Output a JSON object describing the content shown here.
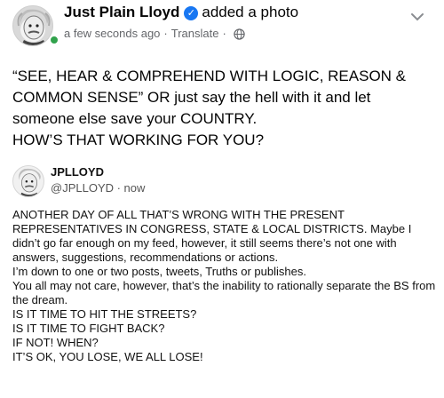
{
  "post": {
    "author": "Just Plain Lloyd",
    "action": "added a photo",
    "timestamp": "a few seconds ago",
    "separator": "·",
    "translate": "Translate",
    "verified_icon": "check-badge",
    "caption": "“SEE, HEAR & COMPREHEND WITH LOGIC, REASON & COMMON SENSE” OR just say the hell with it and let someone else save your COUNTRY.\nHOW’S THAT WORKING FOR YOU?"
  },
  "embedded": {
    "name": "JPLLOYD",
    "handle": "@JPLLOYD · now",
    "body": "ANOTHER DAY OF ALL THAT’S WRONG WITH THE PRESENT REPRESENTATIVES IN CONGRESS, STATE & LOCAL DISTRICTS. Maybe I didn’t go far enough on my feed, however, it still seems there’s not one with answers, suggestions, recommendations or actions.\nI’m down to one or two posts, tweets, Truths or publishes.\nYou all may not care, however, that’s the inability to rationally separate the BS from the dream.\nIS IT TIME TO HIT THE STREETS?\nIS IT TIME TO FIGHT BACK?\nIF NOT! WHEN?\nIT’S OK, YOU LOSE, WE ALL LOSE!"
  },
  "colors": {
    "verified": "#1877f2",
    "online": "#31a24c",
    "meta_text": "#65676b"
  }
}
